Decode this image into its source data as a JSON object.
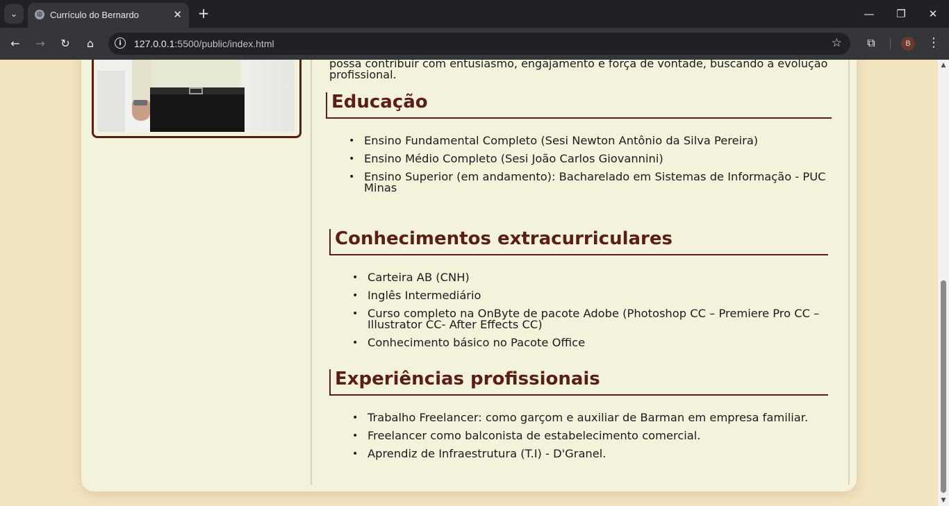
{
  "browser": {
    "tab_title": "Currículo do Bernardo",
    "tab_menu_icon": "chevron-down-icon",
    "new_tab_label": "+",
    "close_tab_label": "✕",
    "url_host": "127.0.0.1",
    "url_rest": ":5500/public/index.html",
    "profile_initial": "B"
  },
  "page": {
    "intro_text": "possa contribuir com entusiasmo, engajamento e força de vontade, buscando a evolução profissional.",
    "sections": [
      {
        "title": "Educação",
        "items": [
          "Ensino Fundamental Completo (Sesi Newton Antônio da Silva Pereira)",
          "Ensino Médio Completo (Sesi João Carlos Giovannini)",
          "Ensino Superior (em andamento): Bacharelado em Sistemas de Informação - PUC Minas"
        ]
      },
      {
        "title": "Conhecimentos extracurriculares",
        "items": [
          "Carteira AB (CNH)",
          "Inglês Intermediário",
          "Curso completo na OnByte de pacote Adobe (Photoshop CC – Premiere Pro CC – Illustrator CC- After Effects CC)",
          "Conhecimento básico no Pacote Office"
        ]
      },
      {
        "title": "Experiências profissionais",
        "items": [
          "Trabalho Freelancer: como garçom e auxiliar de Barman em empresa familiar.",
          "Freelancer como balconista de estabelecimento comercial.",
          "Aprendiz de Infraestrutura (T.I) - D'Granel."
        ]
      }
    ]
  },
  "colors": {
    "page_bg": "#f3e4c0",
    "card_bg": "#f3f3dc",
    "accent": "#5b1e16"
  }
}
